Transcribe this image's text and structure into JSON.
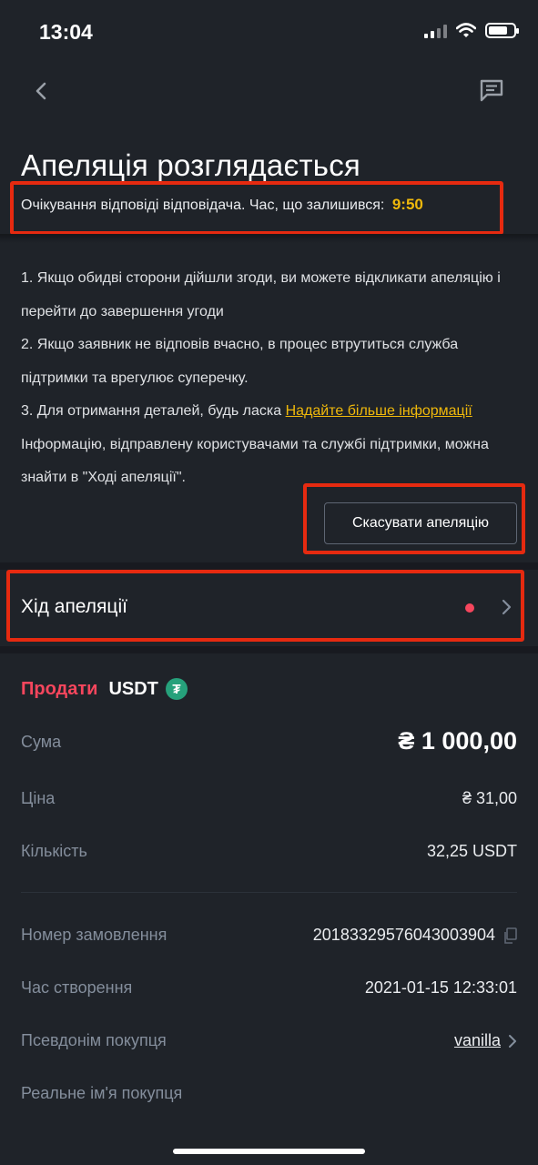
{
  "status_bar": {
    "time": "13:04"
  },
  "header": {
    "title": "Апеляція розглядається",
    "waiting_text": "Очікування відповіді відповідача. Час, що залишився:",
    "timer": "9:50"
  },
  "info": {
    "line1": "1. Якщо обидві сторони дійшли згоди, ви можете відкликати апеляцію і перейти до завершення угоди",
    "line2": "2. Якщо заявник не відповів вчасно, в процес втрутиться служба підтримки та врегулює суперечку.",
    "line3_prefix": "3. Для отримання деталей, будь ласка",
    "line3_link": "Надайте більше інформації",
    "line4": "Інформацію, відправлену користувачами та службі підтримки, можна знайти в \"Ході апеляції\"."
  },
  "cancel_button": "Скасувати апеляцію",
  "appeal_progress": {
    "label": "Хід апеляції"
  },
  "order": {
    "side": "Продати",
    "asset": "USDT",
    "asset_icon": "₮",
    "amount_label": "Сума",
    "amount_value": "₴ 1 000,00",
    "price_label": "Ціна",
    "price_value": "₴ 31,00",
    "quantity_label": "Кількість",
    "quantity_value": "32,25 USDT",
    "order_number_label": "Номер замовлення",
    "order_number_value": "20183329576043003904",
    "created_label": "Час створення",
    "created_value": "2021-01-15 12:33:01",
    "buyer_nick_label": "Псевдонім покупця",
    "buyer_nick_value": "vanilla",
    "buyer_name_label": "Реальне ім'я покупця"
  },
  "colors": {
    "background": "#1f2329",
    "accent": "#f0b90b",
    "sell": "#f6465d",
    "highlight_box": "#e62a10",
    "tether": "#26a17b"
  },
  "icons": [
    "back-arrow-icon",
    "chat-icon",
    "chevron-right-icon",
    "copy-icon",
    "tether-icon",
    "signal-icon",
    "wifi-icon",
    "battery-icon"
  ]
}
